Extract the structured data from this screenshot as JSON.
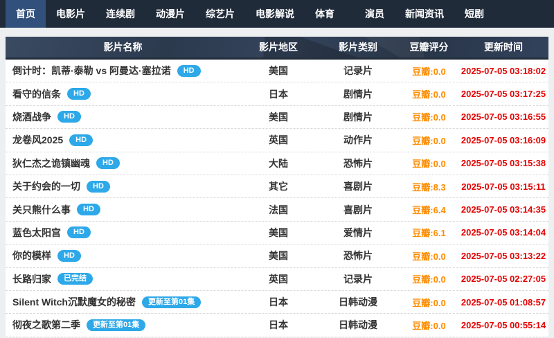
{
  "nav": {
    "items": [
      {
        "label": "首页",
        "active": true
      },
      {
        "label": "电影片",
        "active": false
      },
      {
        "label": "连续剧",
        "active": false
      },
      {
        "label": "动漫片",
        "active": false
      },
      {
        "label": "综艺片",
        "active": false
      },
      {
        "label": "电影解说",
        "active": false
      },
      {
        "label": "体育",
        "active": false
      },
      {
        "label": "演员",
        "active": false,
        "gap_before": true
      },
      {
        "label": "新闻资讯",
        "active": false
      },
      {
        "label": "短剧",
        "active": false
      }
    ]
  },
  "table": {
    "headers": {
      "name": "影片名称",
      "region": "影片地区",
      "category": "影片类别",
      "rating": "豆瓣评分",
      "time": "更新时间"
    },
    "douban_prefix": "豆瓣:",
    "rows": [
      {
        "title": "倒计时：凯蒂·泰勒 vs 阿曼达·塞拉诺",
        "badge": "HD",
        "region": "美国",
        "category": "记录片",
        "rating": "0.0",
        "updated": "2025-07-05 03:18:02"
      },
      {
        "title": "看守的信条",
        "badge": "HD",
        "region": "日本",
        "category": "剧情片",
        "rating": "0.0",
        "updated": "2025-07-05 03:17:25"
      },
      {
        "title": "烧酒战争",
        "badge": "HD",
        "region": "美国",
        "category": "剧情片",
        "rating": "0.0",
        "updated": "2025-07-05 03:16:55"
      },
      {
        "title": "龙卷风2025",
        "badge": "HD",
        "region": "英国",
        "category": "动作片",
        "rating": "0.0",
        "updated": "2025-07-05 03:16:09"
      },
      {
        "title": "狄仁杰之诡镇幽魂",
        "badge": "HD",
        "region": "大陆",
        "category": "恐怖片",
        "rating": "0.0",
        "updated": "2025-07-05 03:15:38"
      },
      {
        "title": "关于约会的一切",
        "badge": "HD",
        "region": "其它",
        "category": "喜剧片",
        "rating": "8.3",
        "updated": "2025-07-05 03:15:11"
      },
      {
        "title": "关只熊什么事",
        "badge": "HD",
        "region": "法国",
        "category": "喜剧片",
        "rating": "6.4",
        "updated": "2025-07-05 03:14:35"
      },
      {
        "title": "蓝色太阳宫",
        "badge": "HD",
        "region": "美国",
        "category": "爱情片",
        "rating": "6.1",
        "updated": "2025-07-05 03:14:04"
      },
      {
        "title": "你的模样",
        "badge": "HD",
        "region": "美国",
        "category": "恐怖片",
        "rating": "0.0",
        "updated": "2025-07-05 03:13:22"
      },
      {
        "title": "长路归家",
        "badge": "已完结",
        "region": "英国",
        "category": "记录片",
        "rating": "0.0",
        "updated": "2025-07-05 02:27:05"
      },
      {
        "title": "Silent Witch沉默魔女的秘密",
        "badge": "更新至第01集",
        "region": "日本",
        "category": "日韩动漫",
        "rating": "0.0",
        "updated": "2025-07-05 01:08:57"
      },
      {
        "title": "彻夜之歌第二季",
        "badge": "更新至第01集",
        "region": "日本",
        "category": "日韩动漫",
        "rating": "0.0",
        "updated": "2025-07-05 00:55:14"
      }
    ]
  },
  "colors": {
    "nav_bg": "#202b3a",
    "nav_active": "#32507c",
    "header_bg": "#2e3c4f",
    "badge_blue": "#2da8e8",
    "rating_orange": "#ff8c00",
    "time_red": "#e60000",
    "page_bg": "#edeff1"
  }
}
